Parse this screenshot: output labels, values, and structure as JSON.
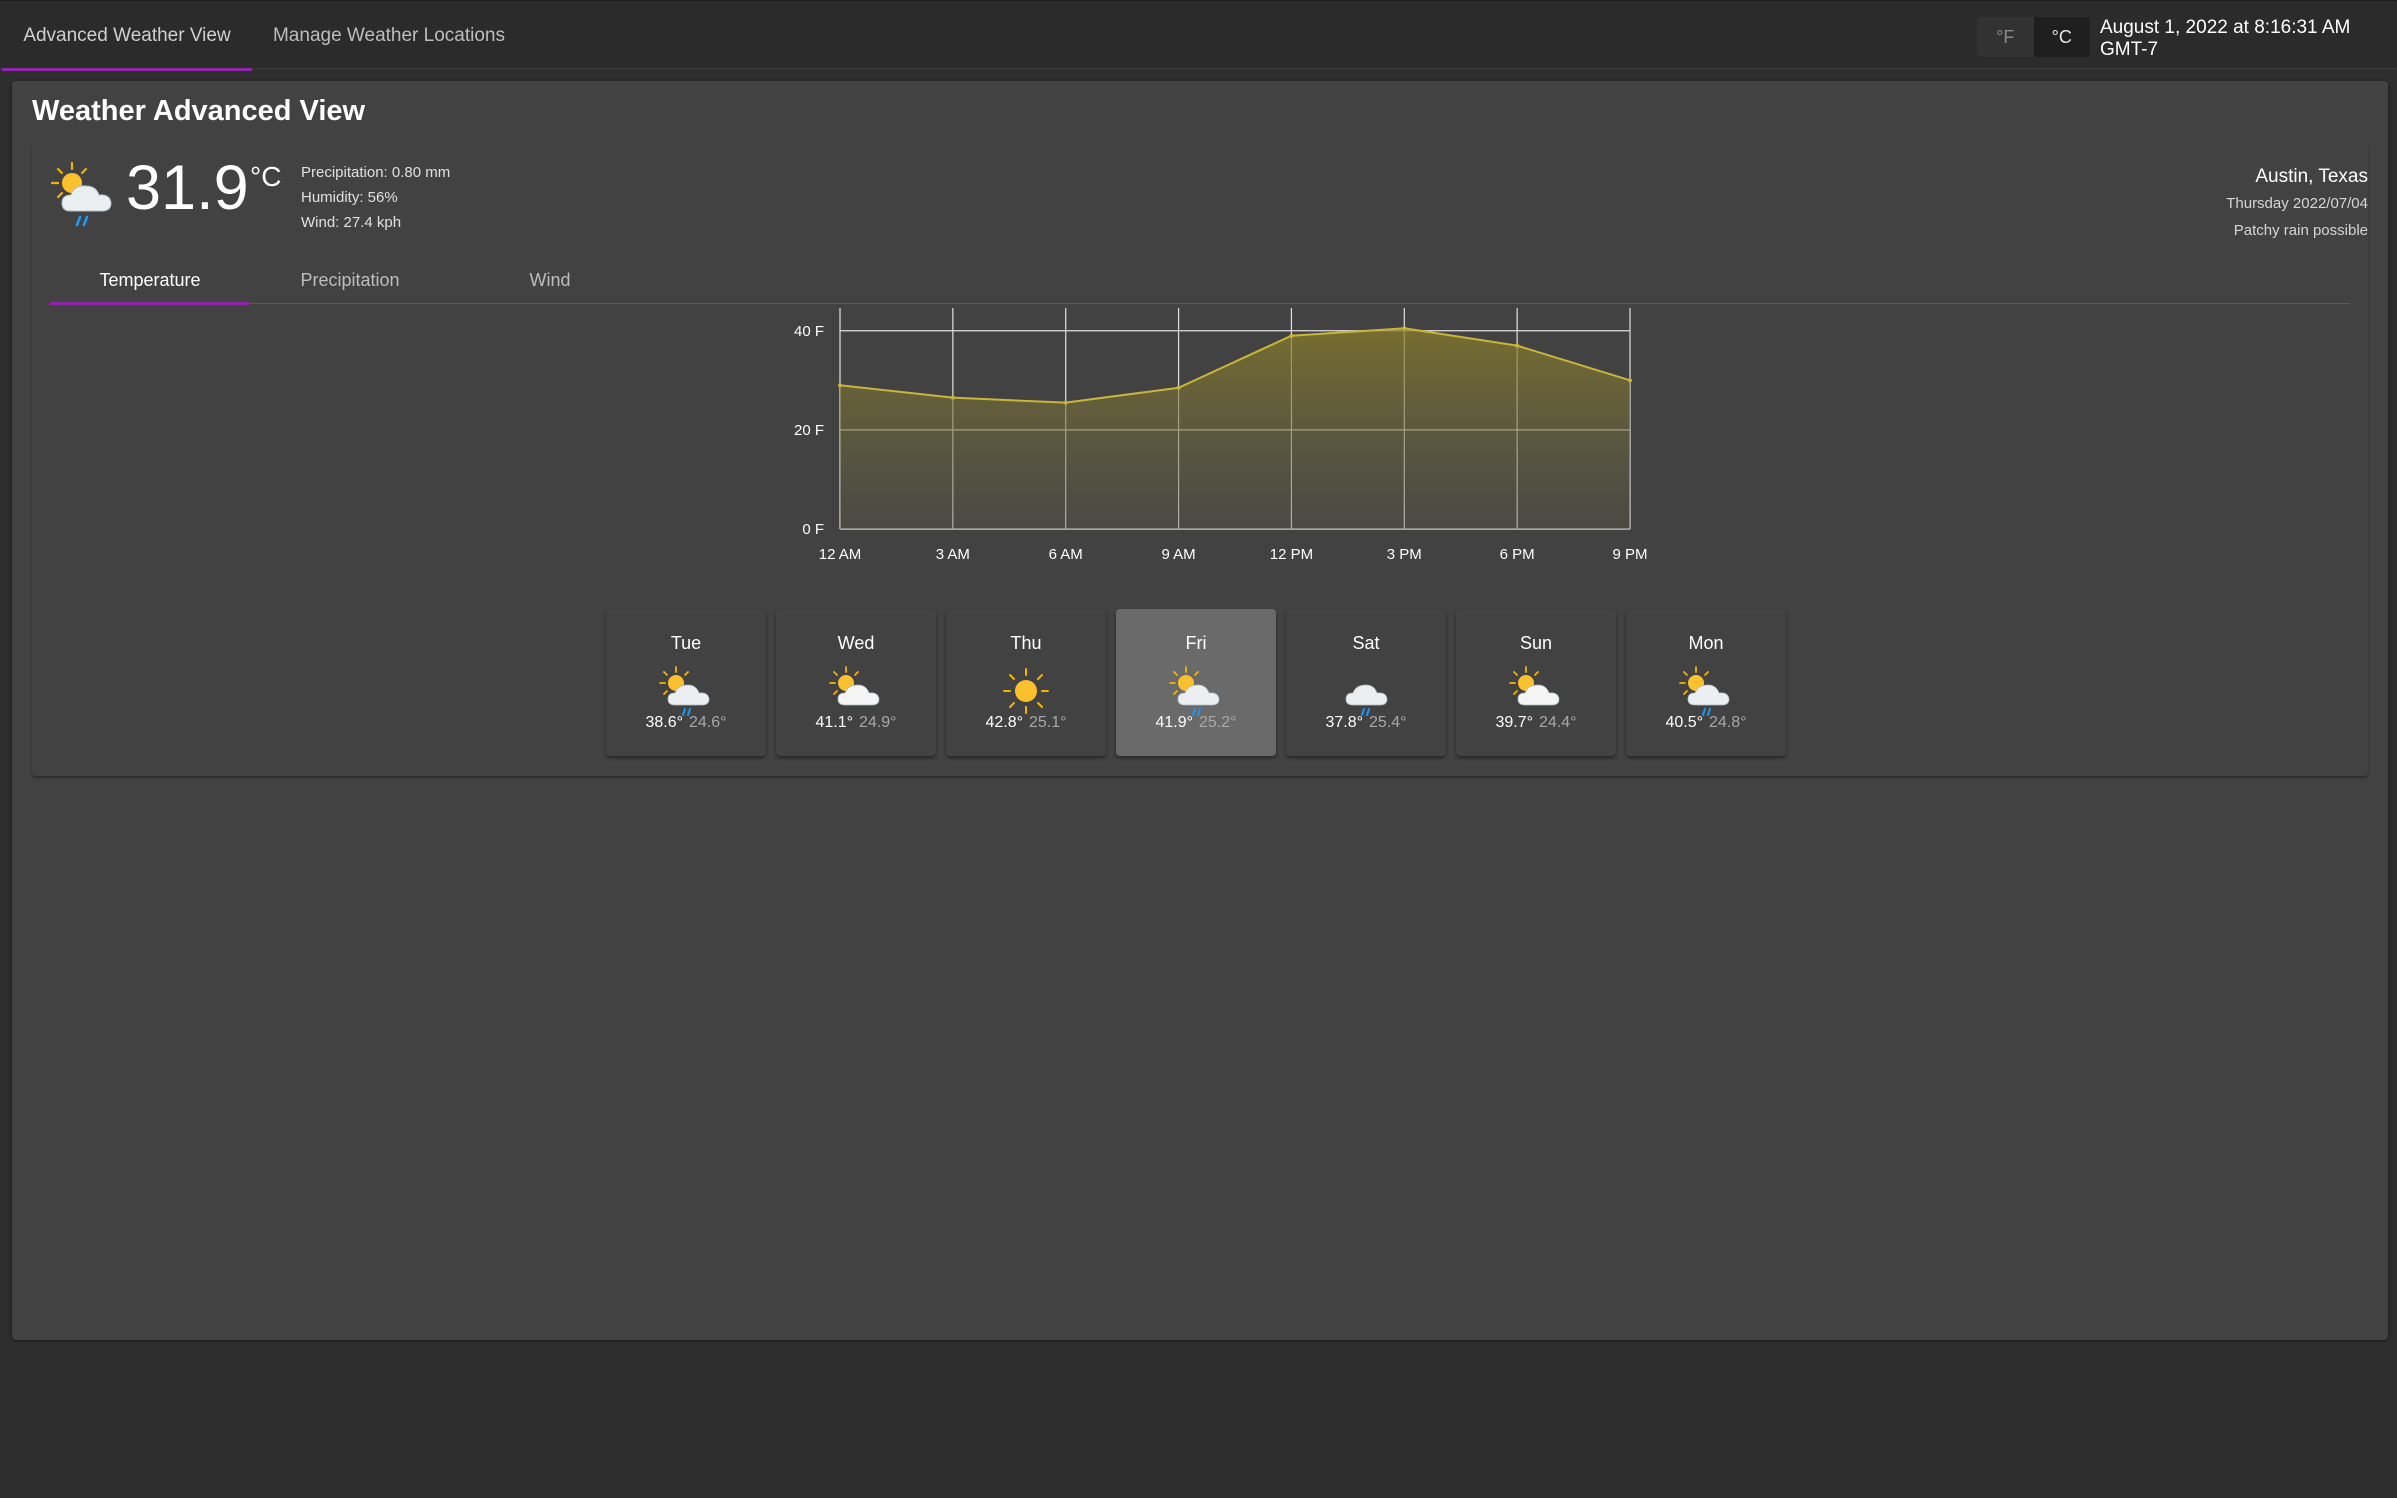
{
  "topbar": {
    "tabs": [
      {
        "label": "Advanced Weather View",
        "active": true
      },
      {
        "label": "Manage Weather Locations",
        "active": false
      }
    ],
    "units": {
      "fahrenheit": "°F",
      "celsius": "°C",
      "selected": "°C"
    },
    "datetime": "August 1, 2022 at 8:16:31 AM GMT-7"
  },
  "panel": {
    "title": "Weather Advanced View"
  },
  "current": {
    "icon": "sun-cloud-rain-icon",
    "temperature": "31.9",
    "unit": "°C",
    "precipitation": "Precipitation: 0.80 mm",
    "humidity": "Humidity: 56%",
    "wind": "Wind: 27.4 kph"
  },
  "location": {
    "name": "Austin, Texas",
    "date": "Thursday 2022/07/04",
    "condition": "Patchy rain possible"
  },
  "subtabs": [
    {
      "label": "Temperature",
      "active": true
    },
    {
      "label": "Precipitation",
      "active": false
    },
    {
      "label": "Wind",
      "active": false
    }
  ],
  "chart_data": {
    "type": "area",
    "categories": [
      "12 AM",
      "3 AM",
      "6 AM",
      "9 AM",
      "12 PM",
      "3 PM",
      "6 PM",
      "9 PM"
    ],
    "series": [
      {
        "values": [
          29,
          26.5,
          25.5,
          28.5,
          39,
          40.5,
          37,
          30
        ]
      }
    ],
    "y_ticks": [
      "0 F",
      "20 F",
      "40 F"
    ],
    "ylim": [
      0,
      45
    ],
    "grid": true,
    "colors": {
      "line": "#c9b53a",
      "fill": "#8a7d2a"
    }
  },
  "forecast": [
    {
      "day": "Tue",
      "icon": "sun-cloud-rain-icon",
      "high": "38.6°",
      "low": "24.6°",
      "selected": false
    },
    {
      "day": "Wed",
      "icon": "sun-cloud-icon",
      "high": "41.1°",
      "low": "24.9°",
      "selected": false
    },
    {
      "day": "Thu",
      "icon": "sun-icon",
      "high": "42.8°",
      "low": "25.1°",
      "selected": false
    },
    {
      "day": "Fri",
      "icon": "sun-cloud-rain-icon",
      "high": "41.9°",
      "low": "25.2°",
      "selected": true
    },
    {
      "day": "Sat",
      "icon": "cloud-rain-icon",
      "high": "37.8°",
      "low": "25.4°",
      "selected": false
    },
    {
      "day": "Sun",
      "icon": "sun-cloud-icon",
      "high": "39.7°",
      "low": "24.4°",
      "selected": false
    },
    {
      "day": "Mon",
      "icon": "sun-cloud-rain-icon",
      "high": "40.5°",
      "low": "24.8°",
      "selected": false
    }
  ],
  "colors": {
    "accent": "#8e24aa",
    "background": "#2e2e2e",
    "panel": "#424242"
  }
}
